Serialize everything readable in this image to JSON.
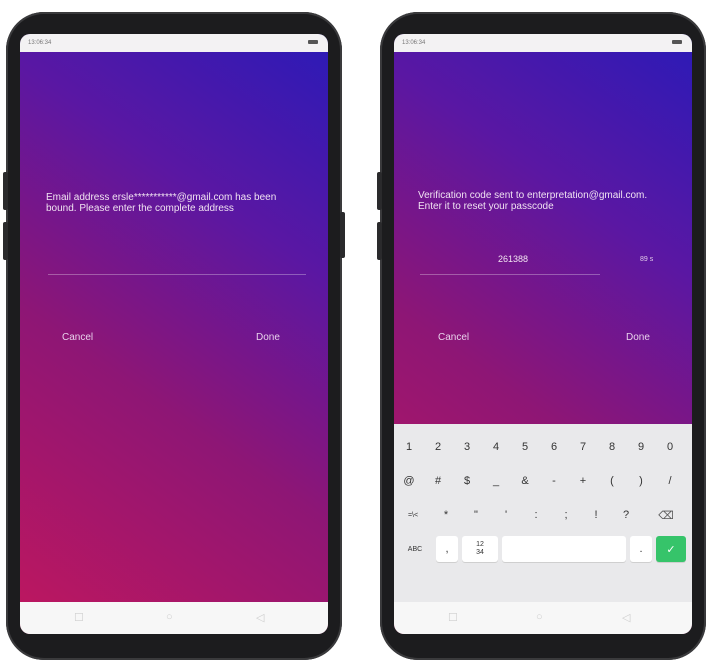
{
  "left_screen": {
    "status_time": "13:06:34 ",
    "message": "Email address ersle***********@gmail.com has been bound. Please enter the complete address",
    "cancel_label": "Cancel",
    "done_label": "Done"
  },
  "right_screen": {
    "status_time": "13:06:34 ",
    "message": "Verification code sent to enterpretation@gmail.com. Enter it to reset your passcode",
    "code_value": "261388",
    "code_suffix": "89 s",
    "cancel_label": "Cancel",
    "done_label": "Done"
  },
  "keyboard": {
    "row1": [
      "1",
      "2",
      "3",
      "4",
      "5",
      "6",
      "7",
      "8",
      "9",
      "0"
    ],
    "row2": [
      "@",
      "#",
      "$",
      "_",
      "&",
      "-",
      "+",
      "(",
      ")",
      "/"
    ],
    "row3": [
      "=\\<",
      "*",
      "\"",
      "'",
      ":",
      ";",
      "!",
      "?"
    ],
    "abc_label": "ABC",
    "comma_label": ",",
    "numpad_label": "12\n34",
    "period_label": "."
  },
  "icons": {
    "back": "back-icon",
    "home": "home-icon",
    "recent": "recent-apps-icon",
    "delete": "backspace-icon",
    "confirm": "check-icon"
  }
}
